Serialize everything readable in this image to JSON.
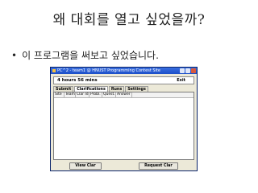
{
  "slide": {
    "title": "왜 대회를 열고 싶었을까?",
    "bullet": "이 프로그램을 써보고 싶었습니다."
  },
  "window": {
    "title": "PC^2 - team1 @ HNUST Programming Contest Site",
    "timer": "4 hours 56 mins",
    "exit_label": "Exit",
    "tabs": [
      {
        "label": "Submit"
      },
      {
        "label": "Clarifications"
      },
      {
        "label": "Runs"
      },
      {
        "label": "Settings"
      }
    ],
    "table_headers": [
      "Site",
      "Team",
      "Clar Id",
      "Probl.",
      "Quest.",
      "Answer"
    ],
    "view_clar_label": "View Clar",
    "request_clar_label": "Request Clar"
  }
}
